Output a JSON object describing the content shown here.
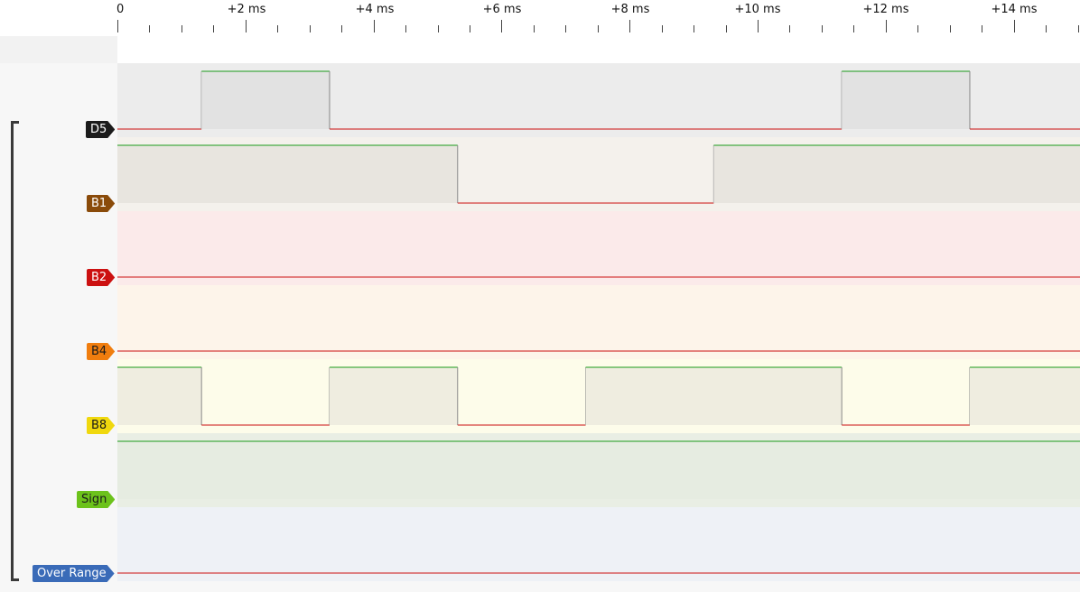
{
  "ruler": {
    "labels": [
      "0",
      "+2 ms",
      "+4 ms",
      "+6 ms",
      "+8 ms",
      "+10 ms",
      "+12 ms",
      "+14 ms"
    ]
  },
  "channels": [
    {
      "name": "D5",
      "label_bg": "#1b1b1b",
      "label_fg": "#ffffff",
      "band_color": "#ececec",
      "high_fill": "#e2e2e2",
      "transitions_ms": [
        1.3,
        3.3,
        11.3,
        13.3
      ],
      "initial_state": "low"
    },
    {
      "name": "B1",
      "label_bg": "#8a4b0a",
      "label_fg": "#ffffff",
      "band_color": "#f4f1ec",
      "high_fill": "#e8e5df",
      "transitions_ms": [
        5.3,
        9.3
      ],
      "initial_state": "high"
    },
    {
      "name": "B2",
      "label_bg": "#cc1111",
      "label_fg": "#ffffff",
      "band_color": "#fbeaea",
      "high_fill": "#f3dede",
      "transitions_ms": [],
      "initial_state": "low"
    },
    {
      "name": "B4",
      "label_bg": "#f07d0e",
      "label_fg": "#1a1a1a",
      "band_color": "#fdf4ea",
      "high_fill": "#f6eadc",
      "transitions_ms": [],
      "initial_state": "low"
    },
    {
      "name": "B8",
      "label_bg": "#f0d80e",
      "label_fg": "#1a1a1a",
      "band_color": "#fdfcea",
      "high_fill": "#efede0",
      "transitions_ms": [
        1.3,
        3.3,
        5.3,
        7.3,
        11.3,
        13.3
      ],
      "initial_state": "high"
    },
    {
      "name": "Sign",
      "label_bg": "#6cc21b",
      "label_fg": "#1a1a1a",
      "band_color": "#e9eee4",
      "high_fill": "#e6ece1",
      "transitions_ms": [],
      "initial_state": "high"
    },
    {
      "name": "Over Range",
      "label_bg": "#3a6bb8",
      "label_fg": "#ffffff",
      "band_color": "#eef1f6",
      "high_fill": "#e4e8f0",
      "transitions_ms": [],
      "initial_state": "low"
    }
  ],
  "colors": {
    "high_line": "#1a9a1a",
    "low_line": "#cc1111",
    "edge": "#888888"
  }
}
